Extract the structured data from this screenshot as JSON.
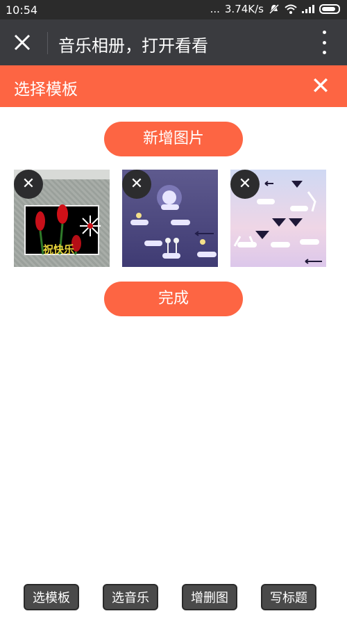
{
  "status_bar": {
    "time": "10:54",
    "network_speed": "3.74K/s",
    "dots": "..."
  },
  "app_bar": {
    "title": "音乐相册，打开看看",
    "close_icon": "close-icon",
    "menu_icon": "more-vert-icon"
  },
  "panel": {
    "title": "选择模板",
    "close_glyph": "✕"
  },
  "add_image_label": "新增图片",
  "done_label": "完成",
  "thumbnails": [
    {
      "remove_glyph": "✕",
      "overlay_text": "祝快乐"
    },
    {
      "remove_glyph": "✕"
    },
    {
      "remove_glyph": "✕"
    }
  ],
  "bottom_nav": [
    "选模板",
    "选音乐",
    "增删图",
    "写标题"
  ],
  "colors": {
    "accent": "#fd6543",
    "app_bar": "#3a3b3f",
    "status_bar": "#2b2b2b",
    "bottom_button": "#4a4a4a"
  }
}
